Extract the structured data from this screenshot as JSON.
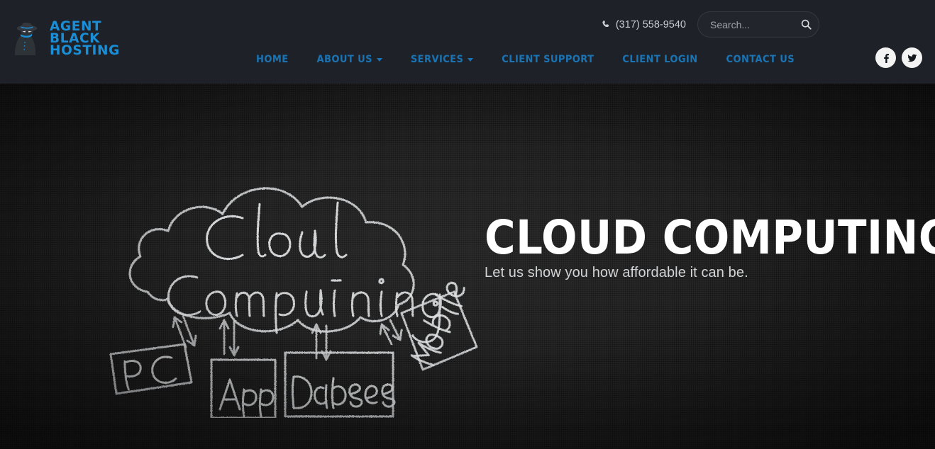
{
  "header": {
    "logo": {
      "icon": "spy-agent-icon",
      "line1": "AGENT",
      "line2": "BLACK",
      "line3": "HOSTING",
      "color": "#1a8fd8"
    },
    "phone": {
      "icon": "phone-icon",
      "number": "(317) 558-9540"
    },
    "search": {
      "placeholder": "Search...",
      "value": "",
      "icon": "search-icon"
    },
    "nav": [
      {
        "label": "HOME",
        "has_dropdown": false
      },
      {
        "label": "ABOUT US",
        "has_dropdown": true
      },
      {
        "label": "SERVICES",
        "has_dropdown": true
      },
      {
        "label": "CLIENT SUPPORT",
        "has_dropdown": false
      },
      {
        "label": "CLIENT LOGIN",
        "has_dropdown": false
      },
      {
        "label": "CONTACT US",
        "has_dropdown": false
      }
    ],
    "nav_color": "#1a73b3",
    "social": [
      {
        "name": "facebook",
        "glyph": "f"
      },
      {
        "name": "twitter",
        "glyph": "t"
      }
    ],
    "background": "#1e2228"
  },
  "hero": {
    "title": "CLOUD COMPUTING",
    "subtitle": "Let us show you how affordable it can be.",
    "background": "#151515",
    "illustration": {
      "style": "chalkboard-sketch",
      "cloud_label_line1": "Cloud",
      "cloud_label_line2": "Computing",
      "nodes": [
        "PC",
        "App",
        "Database",
        "Mobile"
      ]
    }
  }
}
